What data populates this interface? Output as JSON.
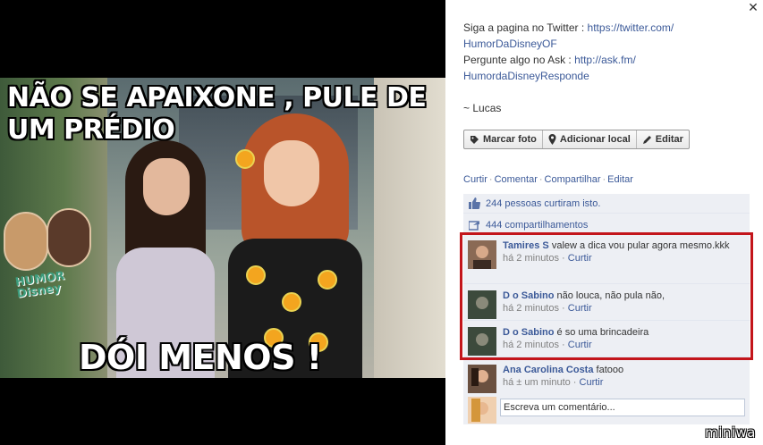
{
  "photo": {
    "top_caption": "NÃO SE APAIXONE , PULE DE UM PRÉDIO",
    "bottom_caption": "DÓI MENOS !",
    "badge_text": "HUMOR Disney"
  },
  "post": {
    "description_line1": "Siga a pagina no Twitter : ",
    "twitter_url": "https://twitter.com/",
    "twitter_handle": "HumorDaDisneyOF",
    "description_line2": "Pergunte algo no Ask : ",
    "ask_url": "http://ask.fm/",
    "ask_handle": "HumordaDisneyResponde",
    "signature": "~ Lucas"
  },
  "photo_tools": {
    "tag_label": "Marcar foto",
    "location_label": "Adicionar local",
    "edit_label": "Editar"
  },
  "actions": {
    "like": "Curtir",
    "comment": "Comentar",
    "share": "Compartilhar",
    "edit": "Editar",
    "separator": "·"
  },
  "stats": {
    "likes": "244 pessoas curtiram isto.",
    "shares": "444 compartilhamentos"
  },
  "comments": [
    {
      "name": "Tamires S",
      "text": "valew a dica vou pular agora mesmo.kkk",
      "time": "há 2 minutos",
      "like": "Curtir"
    },
    {
      "name": "D   o Sabino",
      "text": "não louca, não pula não,",
      "time": "há 2 minutos",
      "like": "Curtir"
    },
    {
      "name": "D   o Sabino",
      "text": "é so uma brincadeira",
      "time": "há 2 minutos",
      "like": "Curtir"
    },
    {
      "name": "Ana Carolina Costa",
      "text": "fatooo",
      "time": "há ± um minuto",
      "like": "Curtir"
    }
  ],
  "write_comment": {
    "placeholder": "Escreva um comentário..."
  },
  "watermark": "miniwa",
  "colors": {
    "link": "#3b5998",
    "highlight": "#c3151b",
    "feed_bg": "#edeff4"
  }
}
